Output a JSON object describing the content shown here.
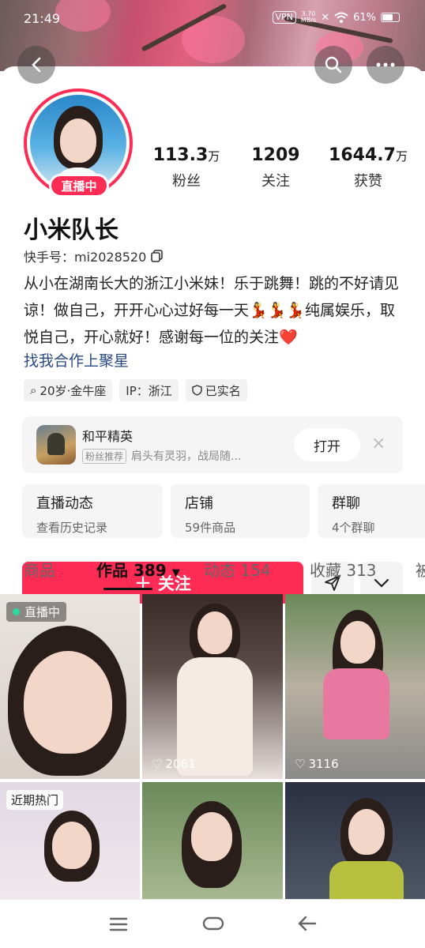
{
  "status_bar": {
    "time": "21:49",
    "vpn": "VPN",
    "speed_top": "3.70",
    "speed_unit": "MB/s",
    "battery": "61%"
  },
  "profile": {
    "live_label": "直播中",
    "stats": [
      {
        "num": "113.3",
        "unit": "万",
        "label": "粉丝"
      },
      {
        "num": "1209",
        "unit": "",
        "label": "关注"
      },
      {
        "num": "1644.7",
        "unit": "万",
        "label": "获赞"
      }
    ],
    "name": "小米队长",
    "kuaishou_id": "快手号：mi2028520",
    "bio": "从小在湖南长大的浙江小米妹！乐于跳舞！跳的不好请见谅！做自己，开开心心过好每一天💃💃💃纯属娱乐，取悦自己，开心就好！感谢每一位的关注❤️",
    "cooperation": "找我合作上聚星",
    "tags": [
      "20岁·金牛座",
      "IP：浙江",
      "已实名"
    ]
  },
  "game_card": {
    "title": "和平精英",
    "badge": "粉丝推荐",
    "desc": "肩头有灵羽，战局随...",
    "open_label": "打开",
    "close": "×"
  },
  "cards": [
    {
      "title": "直播动态",
      "sub": "查看历史记录"
    },
    {
      "title": "店铺",
      "sub": "59件商品"
    },
    {
      "title": "群聊",
      "sub": "4个群聊"
    }
  ],
  "actions": {
    "follow_label": "关注",
    "follow_plus": "+"
  },
  "tabs": [
    "商品",
    "作品 389",
    "动态 154",
    "收藏 313",
    "被"
  ],
  "videos": [
    {
      "chip": "直播中",
      "likes": ""
    },
    {
      "chip": "",
      "likes": "2061"
    },
    {
      "chip": "",
      "likes": "3116"
    },
    {
      "chip": "近期热门",
      "likes": ""
    },
    {
      "chip": "",
      "likes": ""
    },
    {
      "chip": "",
      "likes": ""
    }
  ],
  "colors": {
    "accent": "#fe2c55",
    "link": "#2b4a82"
  }
}
